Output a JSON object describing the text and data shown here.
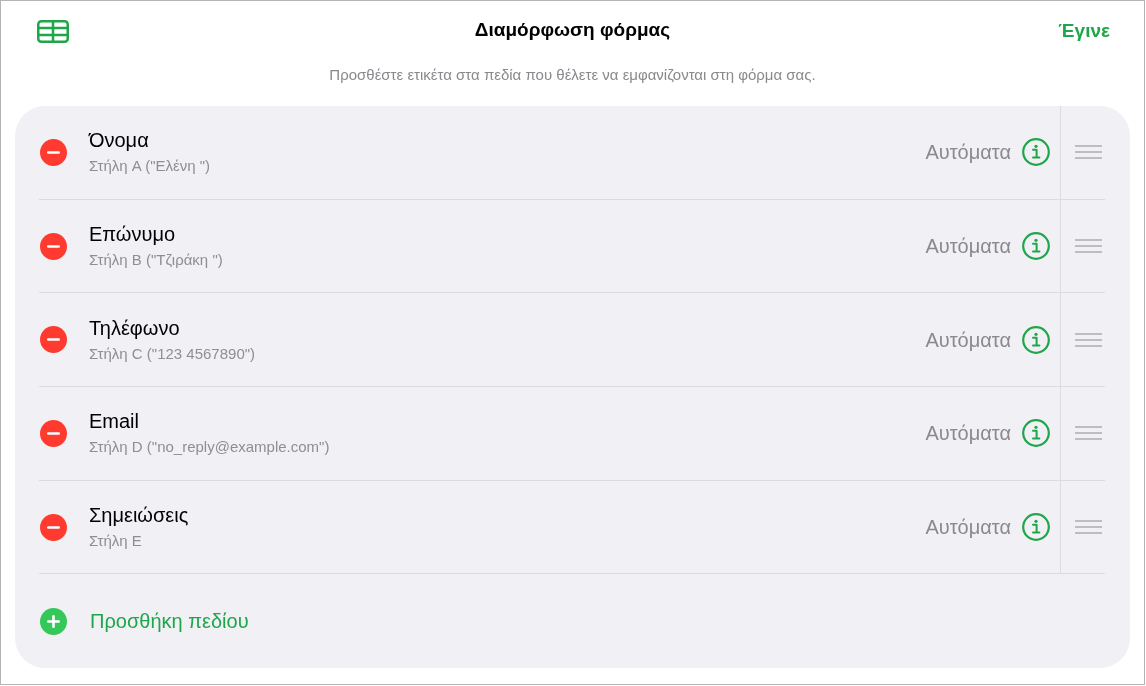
{
  "header": {
    "title": "Διαμόρφωση φόρμας",
    "done_button": "Έγινε",
    "subtitle": "Προσθέστε ετικέτα στα πεδία που θέλετε να εμφανίζονται στη φόρμα σας."
  },
  "fields": [
    {
      "name": "Όνομα",
      "column": "Στήλη A (\"Ελένη \")",
      "format": "Αυτόματα"
    },
    {
      "name": "Επώνυμο",
      "column": "Στήλη B (\"Τζιράκη \")",
      "format": "Αυτόματα"
    },
    {
      "name": "Τηλέφωνο",
      "column": "Στήλη C (\"123 4567890\")",
      "format": "Αυτόματα"
    },
    {
      "name": "Email",
      "column": "Στήλη D (\"no_reply@example.com\")",
      "format": "Αυτόματα"
    },
    {
      "name": "Σημειώσεις",
      "column": "Στήλη E",
      "format": "Αυτόματα"
    }
  ],
  "add_field": "Προσθήκη πεδίου"
}
